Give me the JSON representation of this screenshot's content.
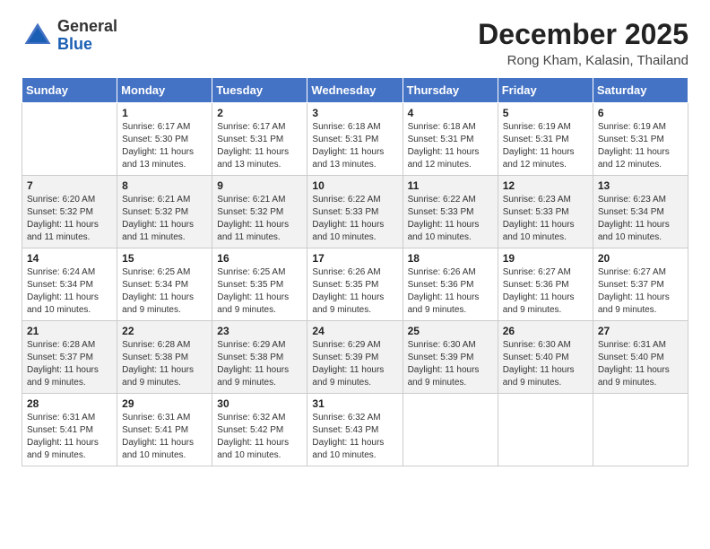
{
  "logo": {
    "general": "General",
    "blue": "Blue"
  },
  "header": {
    "month": "December 2025",
    "location": "Rong Kham, Kalasin, Thailand"
  },
  "weekdays": [
    "Sunday",
    "Monday",
    "Tuesday",
    "Wednesday",
    "Thursday",
    "Friday",
    "Saturday"
  ],
  "weeks": [
    [
      {
        "day": "",
        "info": ""
      },
      {
        "day": "1",
        "info": "Sunrise: 6:17 AM\nSunset: 5:30 PM\nDaylight: 11 hours\nand 13 minutes."
      },
      {
        "day": "2",
        "info": "Sunrise: 6:17 AM\nSunset: 5:31 PM\nDaylight: 11 hours\nand 13 minutes."
      },
      {
        "day": "3",
        "info": "Sunrise: 6:18 AM\nSunset: 5:31 PM\nDaylight: 11 hours\nand 13 minutes."
      },
      {
        "day": "4",
        "info": "Sunrise: 6:18 AM\nSunset: 5:31 PM\nDaylight: 11 hours\nand 12 minutes."
      },
      {
        "day": "5",
        "info": "Sunrise: 6:19 AM\nSunset: 5:31 PM\nDaylight: 11 hours\nand 12 minutes."
      },
      {
        "day": "6",
        "info": "Sunrise: 6:19 AM\nSunset: 5:31 PM\nDaylight: 11 hours\nand 12 minutes."
      }
    ],
    [
      {
        "day": "7",
        "info": "Sunrise: 6:20 AM\nSunset: 5:32 PM\nDaylight: 11 hours\nand 11 minutes."
      },
      {
        "day": "8",
        "info": "Sunrise: 6:21 AM\nSunset: 5:32 PM\nDaylight: 11 hours\nand 11 minutes."
      },
      {
        "day": "9",
        "info": "Sunrise: 6:21 AM\nSunset: 5:32 PM\nDaylight: 11 hours\nand 11 minutes."
      },
      {
        "day": "10",
        "info": "Sunrise: 6:22 AM\nSunset: 5:33 PM\nDaylight: 11 hours\nand 10 minutes."
      },
      {
        "day": "11",
        "info": "Sunrise: 6:22 AM\nSunset: 5:33 PM\nDaylight: 11 hours\nand 10 minutes."
      },
      {
        "day": "12",
        "info": "Sunrise: 6:23 AM\nSunset: 5:33 PM\nDaylight: 11 hours\nand 10 minutes."
      },
      {
        "day": "13",
        "info": "Sunrise: 6:23 AM\nSunset: 5:34 PM\nDaylight: 11 hours\nand 10 minutes."
      }
    ],
    [
      {
        "day": "14",
        "info": "Sunrise: 6:24 AM\nSunset: 5:34 PM\nDaylight: 11 hours\nand 10 minutes."
      },
      {
        "day": "15",
        "info": "Sunrise: 6:25 AM\nSunset: 5:34 PM\nDaylight: 11 hours\nand 9 minutes."
      },
      {
        "day": "16",
        "info": "Sunrise: 6:25 AM\nSunset: 5:35 PM\nDaylight: 11 hours\nand 9 minutes."
      },
      {
        "day": "17",
        "info": "Sunrise: 6:26 AM\nSunset: 5:35 PM\nDaylight: 11 hours\nand 9 minutes."
      },
      {
        "day": "18",
        "info": "Sunrise: 6:26 AM\nSunset: 5:36 PM\nDaylight: 11 hours\nand 9 minutes."
      },
      {
        "day": "19",
        "info": "Sunrise: 6:27 AM\nSunset: 5:36 PM\nDaylight: 11 hours\nand 9 minutes."
      },
      {
        "day": "20",
        "info": "Sunrise: 6:27 AM\nSunset: 5:37 PM\nDaylight: 11 hours\nand 9 minutes."
      }
    ],
    [
      {
        "day": "21",
        "info": "Sunrise: 6:28 AM\nSunset: 5:37 PM\nDaylight: 11 hours\nand 9 minutes."
      },
      {
        "day": "22",
        "info": "Sunrise: 6:28 AM\nSunset: 5:38 PM\nDaylight: 11 hours\nand 9 minutes."
      },
      {
        "day": "23",
        "info": "Sunrise: 6:29 AM\nSunset: 5:38 PM\nDaylight: 11 hours\nand 9 minutes."
      },
      {
        "day": "24",
        "info": "Sunrise: 6:29 AM\nSunset: 5:39 PM\nDaylight: 11 hours\nand 9 minutes."
      },
      {
        "day": "25",
        "info": "Sunrise: 6:30 AM\nSunset: 5:39 PM\nDaylight: 11 hours\nand 9 minutes."
      },
      {
        "day": "26",
        "info": "Sunrise: 6:30 AM\nSunset: 5:40 PM\nDaylight: 11 hours\nand 9 minutes."
      },
      {
        "day": "27",
        "info": "Sunrise: 6:31 AM\nSunset: 5:40 PM\nDaylight: 11 hours\nand 9 minutes."
      }
    ],
    [
      {
        "day": "28",
        "info": "Sunrise: 6:31 AM\nSunset: 5:41 PM\nDaylight: 11 hours\nand 9 minutes."
      },
      {
        "day": "29",
        "info": "Sunrise: 6:31 AM\nSunset: 5:41 PM\nDaylight: 11 hours\nand 10 minutes."
      },
      {
        "day": "30",
        "info": "Sunrise: 6:32 AM\nSunset: 5:42 PM\nDaylight: 11 hours\nand 10 minutes."
      },
      {
        "day": "31",
        "info": "Sunrise: 6:32 AM\nSunset: 5:43 PM\nDaylight: 11 hours\nand 10 minutes."
      },
      {
        "day": "",
        "info": ""
      },
      {
        "day": "",
        "info": ""
      },
      {
        "day": "",
        "info": ""
      }
    ]
  ]
}
